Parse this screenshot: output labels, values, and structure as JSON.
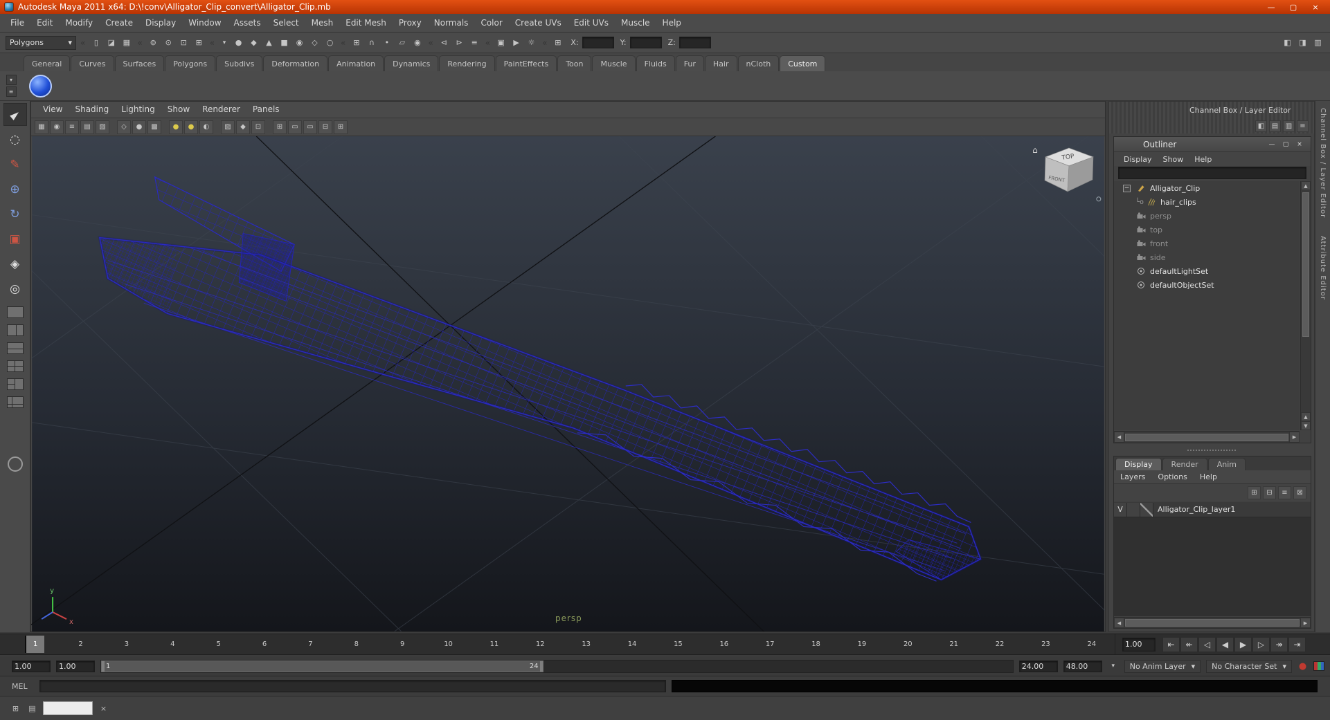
{
  "colors": {
    "titlebar": "#cf3d0a",
    "wireframe": "#2a2ac2",
    "viewport_top": "#3a414c",
    "viewport_bottom": "#14161b",
    "camera_label": "#8a9a5a",
    "light_icon": "#dcca4c"
  },
  "icons": {
    "up": "▲",
    "down": "▼",
    "left": "◀",
    "right": "▶",
    "dropdown": "▾",
    "collapse": "«",
    "minus": "−",
    "home": "⌂",
    "close": "×",
    "maximize": "▢",
    "minimize": "—"
  },
  "titlebar": {
    "title": "Autodesk Maya 2011 x64: D:\\!conv\\Alligator_Clip_convert\\Alligator_Clip.mb"
  },
  "menubar": {
    "items": [
      "File",
      "Edit",
      "Modify",
      "Create",
      "Display",
      "Window",
      "Assets",
      "Select",
      "Mesh",
      "Edit Mesh",
      "Proxy",
      "Normals",
      "Color",
      "Create UVs",
      "Edit UVs",
      "Muscle",
      "Help"
    ]
  },
  "statusline": {
    "menuset": "Polygons",
    "file_icons": [
      {
        "name": "new-scene-icon",
        "glyph": "▯"
      },
      {
        "name": "open-scene-icon",
        "glyph": "◪"
      },
      {
        "name": "save-scene-icon",
        "glyph": "▦"
      }
    ],
    "selection_mode_icons": [
      {
        "name": "select-hierarchy-icon",
        "glyph": "⊚"
      },
      {
        "name": "select-object-icon",
        "glyph": "⊙"
      },
      {
        "name": "select-component-icon",
        "glyph": "⊡"
      },
      {
        "name": "select-highlight-icon",
        "glyph": "⊞"
      }
    ],
    "mask_dropdown_glyph": "▾",
    "mask_icons": [
      {
        "name": "mask-handles-icon",
        "glyph": "●"
      },
      {
        "name": "mask-points-icon",
        "glyph": "◆"
      },
      {
        "name": "mask-curves-icon",
        "glyph": "▲"
      },
      {
        "name": "mask-surfaces-icon",
        "glyph": "■"
      },
      {
        "name": "mask-dynamics-icon",
        "glyph": "◉"
      },
      {
        "name": "mask-rendering-icon",
        "glyph": "◇"
      },
      {
        "name": "mask-misc-icon",
        "glyph": "○"
      }
    ],
    "snap_icons": [
      {
        "name": "snap-to-grid-icon",
        "glyph": "⊞"
      },
      {
        "name": "snap-to-curve-icon",
        "glyph": "∩"
      },
      {
        "name": "snap-to-point-icon",
        "glyph": "•"
      },
      {
        "name": "snap-to-plane-icon",
        "glyph": "▱"
      },
      {
        "name": "make-live-icon",
        "glyph": "◉"
      }
    ],
    "history_icons": [
      {
        "name": "input-connections-icon",
        "glyph": "⊲"
      },
      {
        "name": "output-connections-icon",
        "glyph": "⊳"
      },
      {
        "name": "construction-history-icon",
        "glyph": "≡"
      }
    ],
    "render_icons": [
      {
        "name": "render-current-frame-icon",
        "glyph": "▣"
      },
      {
        "name": "ipr-render-icon",
        "glyph": "▶"
      },
      {
        "name": "render-settings-icon",
        "glyph": "☼"
      }
    ],
    "xyz_mode_glyph": "⊞",
    "x_label": "X:",
    "y_label": "Y:",
    "z_label": "Z:",
    "x_value": "",
    "y_value": "",
    "z_value": "",
    "sidebar_icons": [
      {
        "name": "show-channel-box-icon",
        "glyph": "◧"
      },
      {
        "name": "show-tool-settings-icon",
        "glyph": "◨"
      },
      {
        "name": "show-attribute-editor-icon",
        "glyph": "▥"
      }
    ]
  },
  "shelf": {
    "tabs": [
      "General",
      "Curves",
      "Surfaces",
      "Polygons",
      "Subdivs",
      "Deformation",
      "Animation",
      "Dynamics",
      "Rendering",
      "PaintEffects",
      "Toon",
      "Muscle",
      "Fluids",
      "Fur",
      "Hair",
      "nCloth",
      "Custom"
    ],
    "selected_tab": "Custom",
    "menu_icons": [
      {
        "name": "shelf-tab-menu-icon",
        "glyph": "▾"
      },
      {
        "name": "shelf-options-menu-icon",
        "glyph": "≡"
      }
    ]
  },
  "toolbox": {
    "tools": [
      {
        "name": "select-tool-icon",
        "glyph": "►"
      },
      {
        "name": "lasso-select-icon",
        "glyph": "◌"
      },
      {
        "name": "paint-select-icon",
        "glyph": "✎"
      },
      {
        "name": "move-tool-icon",
        "glyph": "⊕"
      },
      {
        "name": "rotate-tool-icon",
        "glyph": "↻"
      },
      {
        "name": "scale-tool-icon",
        "glyph": "▣"
      },
      {
        "name": "universal-manipulator-icon",
        "glyph": "◈"
      },
      {
        "name": "soft-mod-icon",
        "glyph": "◎"
      }
    ]
  },
  "viewport": {
    "menus": [
      "View",
      "Shading",
      "Lighting",
      "Show",
      "Renderer",
      "Panels"
    ],
    "toolbar_icons": [
      {
        "name": "select-camera-icon",
        "glyph": "▦"
      },
      {
        "name": "lock-camera-icon",
        "glyph": "◉"
      },
      {
        "name": "camera-attributes-icon",
        "glyph": "≡"
      },
      {
        "name": "bookmarks-icon",
        "glyph": "▤"
      },
      {
        "name": "image-plane-icon",
        "glyph": "▧"
      },
      {
        "name": "wireframe-icon",
        "glyph": "◇"
      },
      {
        "name": "smooth-shade-icon",
        "glyph": "●"
      },
      {
        "name": "textured-icon",
        "glyph": "▩"
      },
      {
        "name": "use-default-light-icon",
        "glyph": "●"
      },
      {
        "name": "use-all-lights-icon",
        "glyph": "●"
      },
      {
        "name": "shadows-icon",
        "glyph": "◐"
      },
      {
        "name": "xray-icon",
        "glyph": "▨"
      },
      {
        "name": "backface-culling-icon",
        "glyph": "◆"
      },
      {
        "name": "isolate-select-icon",
        "glyph": "⊡"
      },
      {
        "name": "field-chart-icon",
        "glyph": "⊞"
      },
      {
        "name": "resolution-gate-icon",
        "glyph": "▭"
      },
      {
        "name": "film-gate-icon",
        "glyph": "▭"
      },
      {
        "name": "safe-display-icon",
        "glyph": "⊟"
      },
      {
        "name": "grid-toggle-icon",
        "glyph": "⊞"
      }
    ],
    "camera_label": "persp",
    "viewcube": {
      "top_label": "TOP",
      "front_label": "FRONT"
    },
    "axis_labels": {
      "x": "x",
      "y": "y"
    }
  },
  "right_panel": {
    "header": "Channel Box / Layer Editor",
    "minibar_icons": [
      {
        "name": "channel-box-mode-icon",
        "glyph": "◧"
      },
      {
        "name": "layer-editor-mode-icon",
        "glyph": "▤"
      },
      {
        "name": "split-view-icon",
        "glyph": "▥"
      },
      {
        "name": "panel-menu-icon",
        "glyph": "≡"
      }
    ],
    "outliner": {
      "title": "Outliner",
      "menus": [
        "Display",
        "Show",
        "Help"
      ],
      "search_value": "",
      "connector": "└o",
      "items": [
        {
          "label": "Alligator_Clip"
        },
        {
          "label": "hair_clips"
        },
        {
          "label": "persp"
        },
        {
          "label": "top"
        },
        {
          "label": "front"
        },
        {
          "label": "side"
        },
        {
          "label": "defaultLightSet"
        },
        {
          "label": "defaultObjectSet"
        }
      ]
    },
    "layer_editor": {
      "tabs": [
        "Display",
        "Render",
        "Anim"
      ],
      "selected_tab": "Display",
      "menus": [
        "Layers",
        "Options",
        "Help"
      ],
      "icons": [
        {
          "name": "new-empty-layer-icon",
          "glyph": "⊞"
        },
        {
          "name": "new-layer-assign-icon",
          "glyph": "⊟"
        },
        {
          "name": "sort-layers-icon",
          "glyph": "≡"
        },
        {
          "name": "layer-attributes-icon",
          "glyph": "⊠"
        }
      ],
      "layers": [
        {
          "visibility": "V",
          "name": "Alligator_Clip_layer1"
        }
      ]
    }
  },
  "side_tabs": [
    "Channel Box / Layer Editor",
    "Attribute Editor"
  ],
  "timeline": {
    "frames": [
      "1",
      "2",
      "3",
      "4",
      "5",
      "6",
      "7",
      "8",
      "9",
      "10",
      "11",
      "12",
      "13",
      "14",
      "15",
      "16",
      "17",
      "18",
      "19",
      "20",
      "21",
      "22",
      "23",
      "24"
    ],
    "current_frame": "1",
    "current_time": "1.00",
    "playback_icons": [
      {
        "name": "go-to-start-button",
        "glyph": "⇤"
      },
      {
        "name": "step-back-frame-button",
        "glyph": "↞"
      },
      {
        "name": "step-back-key-button",
        "glyph": "◁"
      },
      {
        "name": "play-backwards-button",
        "glyph": "◀"
      },
      {
        "name": "play-forwards-button",
        "glyph": "▶"
      },
      {
        "name": "step-forward-key-button",
        "glyph": "▷"
      },
      {
        "name": "step-forward-frame-button",
        "glyph": "↠"
      },
      {
        "name": "go-to-end-button",
        "glyph": "⇥"
      }
    ]
  },
  "range": {
    "playback_start": "1.00",
    "anim_start": "1.00",
    "range_start": "1",
    "range_end": "24",
    "playback_end": "24.00",
    "anim_end": "48.00",
    "anim_layer": "No Anim Layer",
    "character_set": "No Character Set"
  },
  "command_line": {
    "label": "MEL",
    "input_value": "",
    "output_value": ""
  },
  "bottom_bar": {
    "icons": [
      {
        "name": "grid-icon",
        "glyph": "⊞"
      },
      {
        "name": "document-icon",
        "glyph": "▤"
      },
      {
        "name": "close-icon",
        "glyph": "×"
      }
    ]
  }
}
